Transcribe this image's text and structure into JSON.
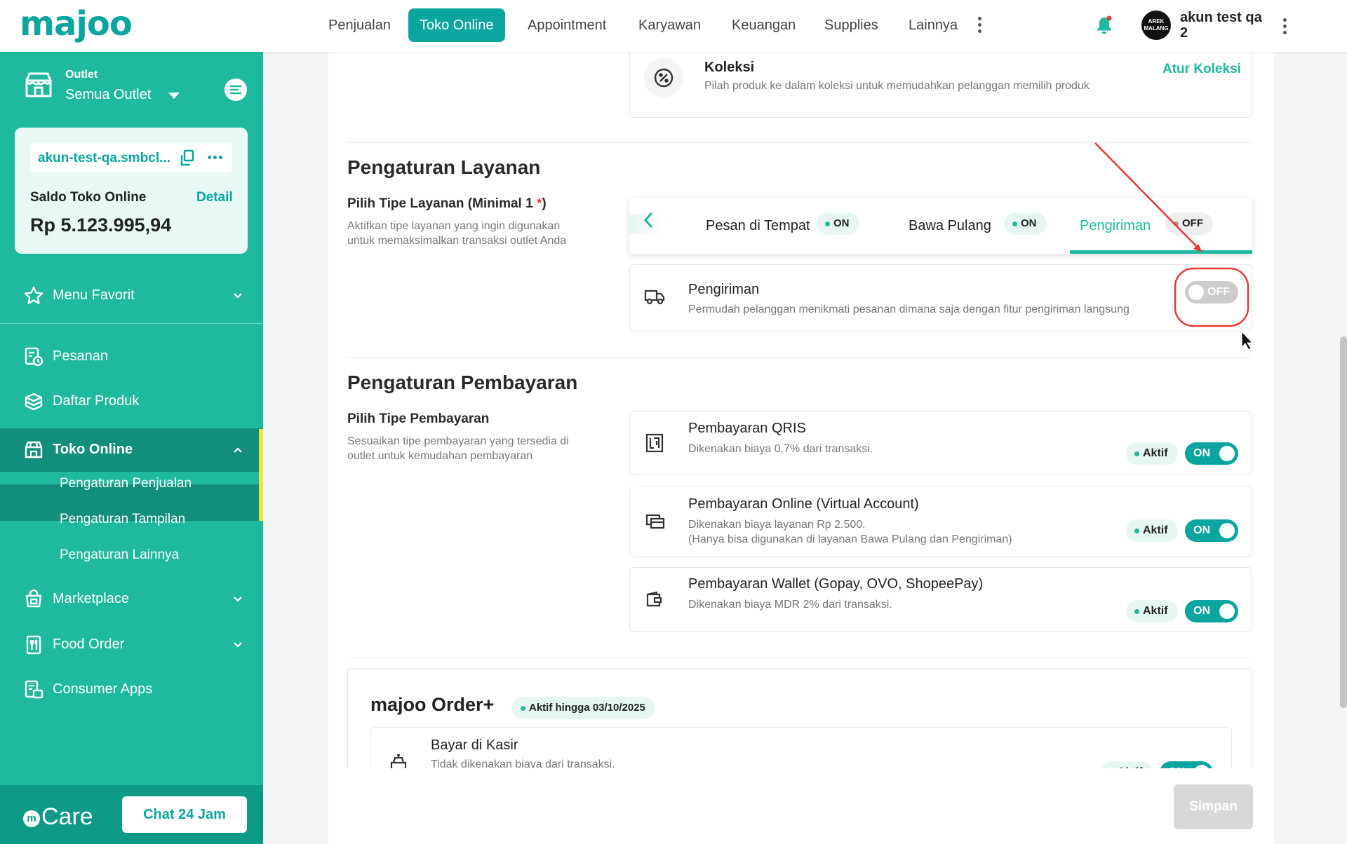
{
  "brand": {
    "logo": "majoo",
    "accent": "#1fb99f"
  },
  "nav": {
    "items": [
      "Penjualan",
      "Toko Online",
      "Appointment",
      "Karyawan",
      "Keuangan",
      "Supplies",
      "Lainnya"
    ],
    "active": "Toko Online"
  },
  "user": {
    "avatar_text": "AREK MALANG",
    "name": "akun test qa 2"
  },
  "sidebar": {
    "outlet_label": "Outlet",
    "outlet_value": "Semua Outlet",
    "store_url": "akun-test-qa.smbcl...",
    "saldo_label": "Saldo Toko Online",
    "saldo_detail": "Detail",
    "saldo_value": "Rp 5.123.995,94",
    "favorites": "Menu Favorit",
    "items": [
      "Pesanan",
      "Daftar Produk",
      "Toko Online",
      "Marketplace",
      "Food Order",
      "Consumer Apps"
    ],
    "subitems": [
      "Pengaturan Penjualan",
      "Pengaturan Tampilan",
      "Pengaturan Lainnya"
    ],
    "care_label": "Care",
    "chat_button": "Chat 24 Jam"
  },
  "koleksi": {
    "title": "Koleksi",
    "desc": "Pilah produk ke dalam koleksi untuk memudahkan pelanggan memilih produk",
    "action": "Atur Koleksi"
  },
  "layanan": {
    "heading": "Pengaturan Layanan",
    "label": "Pilih Tipe Layanan (Minimal 1 ",
    "required": "*",
    "label_end": ")",
    "desc1": "Aktifkan tipe layanan yang ingin digunakan",
    "desc2": "untuk memaksimalkan transaksi outlet Anda",
    "tabs": [
      {
        "label": "Pesan di Tempat",
        "status": "ON"
      },
      {
        "label": "Bawa Pulang",
        "status": "ON"
      },
      {
        "label": "Pengiriman",
        "status": "OFF"
      }
    ],
    "card_title": "Pengiriman",
    "card_desc": "Permudah pelanggan menikmati pesanan dimana saja dengan fitur pengiriman langsung",
    "card_toggle": "OFF"
  },
  "pembayaran": {
    "heading": "Pengaturan Pembayaran",
    "label": "Pilih Tipe Pembayaran",
    "desc1": "Sesuaikan tipe pembayaran yang tersedia di",
    "desc2": "outlet untuk kemudahan pembayaran",
    "options": [
      {
        "title": "Pembayaran QRIS",
        "desc1": "Dikenakan biaya 0.7% dari transaksi.",
        "desc2": "",
        "badge": "Aktif",
        "toggle": "ON"
      },
      {
        "title": "Pembayaran Online (Virtual Account)",
        "desc1": "Dikenakan biaya layanan Rp 2.500.",
        "desc2": "(Hanya bisa digunakan di layanan Bawa Pulang dan Pengiriman)",
        "badge": "Aktif",
        "toggle": "ON"
      },
      {
        "title": "Pembayaran Wallet (Gopay, OVO, ShopeePay)",
        "desc1": "Dikenakan biaya MDR 2% dari transaksi.",
        "desc2": "",
        "badge": "Aktif",
        "toggle": "ON"
      }
    ]
  },
  "order_plus": {
    "title": "majoo Order+",
    "badge": "Aktif hingga 03/10/2025",
    "item_title": "Bayar di Kasir",
    "item_desc": "Tidak dikenakan biaya dari transaksi.",
    "item_badge": "Aktif",
    "item_toggle": "ON"
  },
  "save_button": "Simpan"
}
